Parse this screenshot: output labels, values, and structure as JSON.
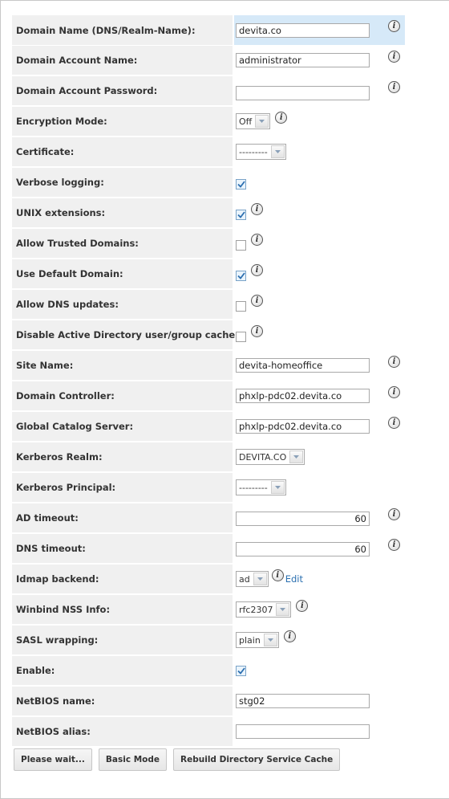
{
  "fields": {
    "domain_name": {
      "label": "Domain Name (DNS/Realm-Name):",
      "value": "devita.co"
    },
    "account_name": {
      "label": "Domain Account Name:",
      "value": "administrator"
    },
    "account_password": {
      "label": "Domain Account Password:",
      "value": ""
    },
    "encryption_mode": {
      "label": "Encryption Mode:",
      "value": "Off"
    },
    "certificate": {
      "label": "Certificate:",
      "value": "---------"
    },
    "verbose_logging": {
      "label": "Verbose logging:",
      "checked": true
    },
    "unix_extensions": {
      "label": "UNIX extensions:",
      "checked": true
    },
    "allow_trusted": {
      "label": "Allow Trusted Domains:",
      "checked": false
    },
    "use_default_domain": {
      "label": "Use Default Domain:",
      "checked": true
    },
    "allow_dns_updates": {
      "label": "Allow DNS updates:",
      "checked": false
    },
    "disable_ad_cache": {
      "label": "Disable Active Directory user/group cache:",
      "checked": false
    },
    "site_name": {
      "label": "Site Name:",
      "value": "devita-homeoffice"
    },
    "domain_controller": {
      "label": "Domain Controller:",
      "value": "phxlp-pdc02.devita.co"
    },
    "global_catalog": {
      "label": "Global Catalog Server:",
      "value": "phxlp-pdc02.devita.co"
    },
    "kerberos_realm": {
      "label": "Kerberos Realm:",
      "value": "DEVITA.CO"
    },
    "kerberos_principal": {
      "label": "Kerberos Principal:",
      "value": "---------"
    },
    "ad_timeout": {
      "label": "AD timeout:",
      "value": "60"
    },
    "dns_timeout": {
      "label": "DNS timeout:",
      "value": "60"
    },
    "idmap_backend": {
      "label": "Idmap backend:",
      "value": "ad",
      "link": "Edit"
    },
    "winbind_nss": {
      "label": "Winbind NSS Info:",
      "value": "rfc2307"
    },
    "sasl_wrapping": {
      "label": "SASL wrapping:",
      "value": "plain"
    },
    "enable": {
      "label": "Enable:",
      "checked": true
    },
    "netbios_name": {
      "label": "NetBIOS name:",
      "value": "stg02"
    },
    "netbios_alias": {
      "label": "NetBIOS alias:",
      "value": ""
    }
  },
  "buttons": {
    "please_wait": "Please wait...",
    "basic_mode": "Basic Mode",
    "rebuild_cache": "Rebuild Directory Service Cache"
  },
  "icons": {
    "info": "info-icon",
    "checkmark": "checkmark-icon",
    "dropdown": "chevron-down-icon"
  },
  "colors": {
    "label_bg": "#f0f0f0",
    "highlight_bg": "#d6e9f8",
    "link": "#2a6fb0",
    "check": "#2c6fb0"
  }
}
